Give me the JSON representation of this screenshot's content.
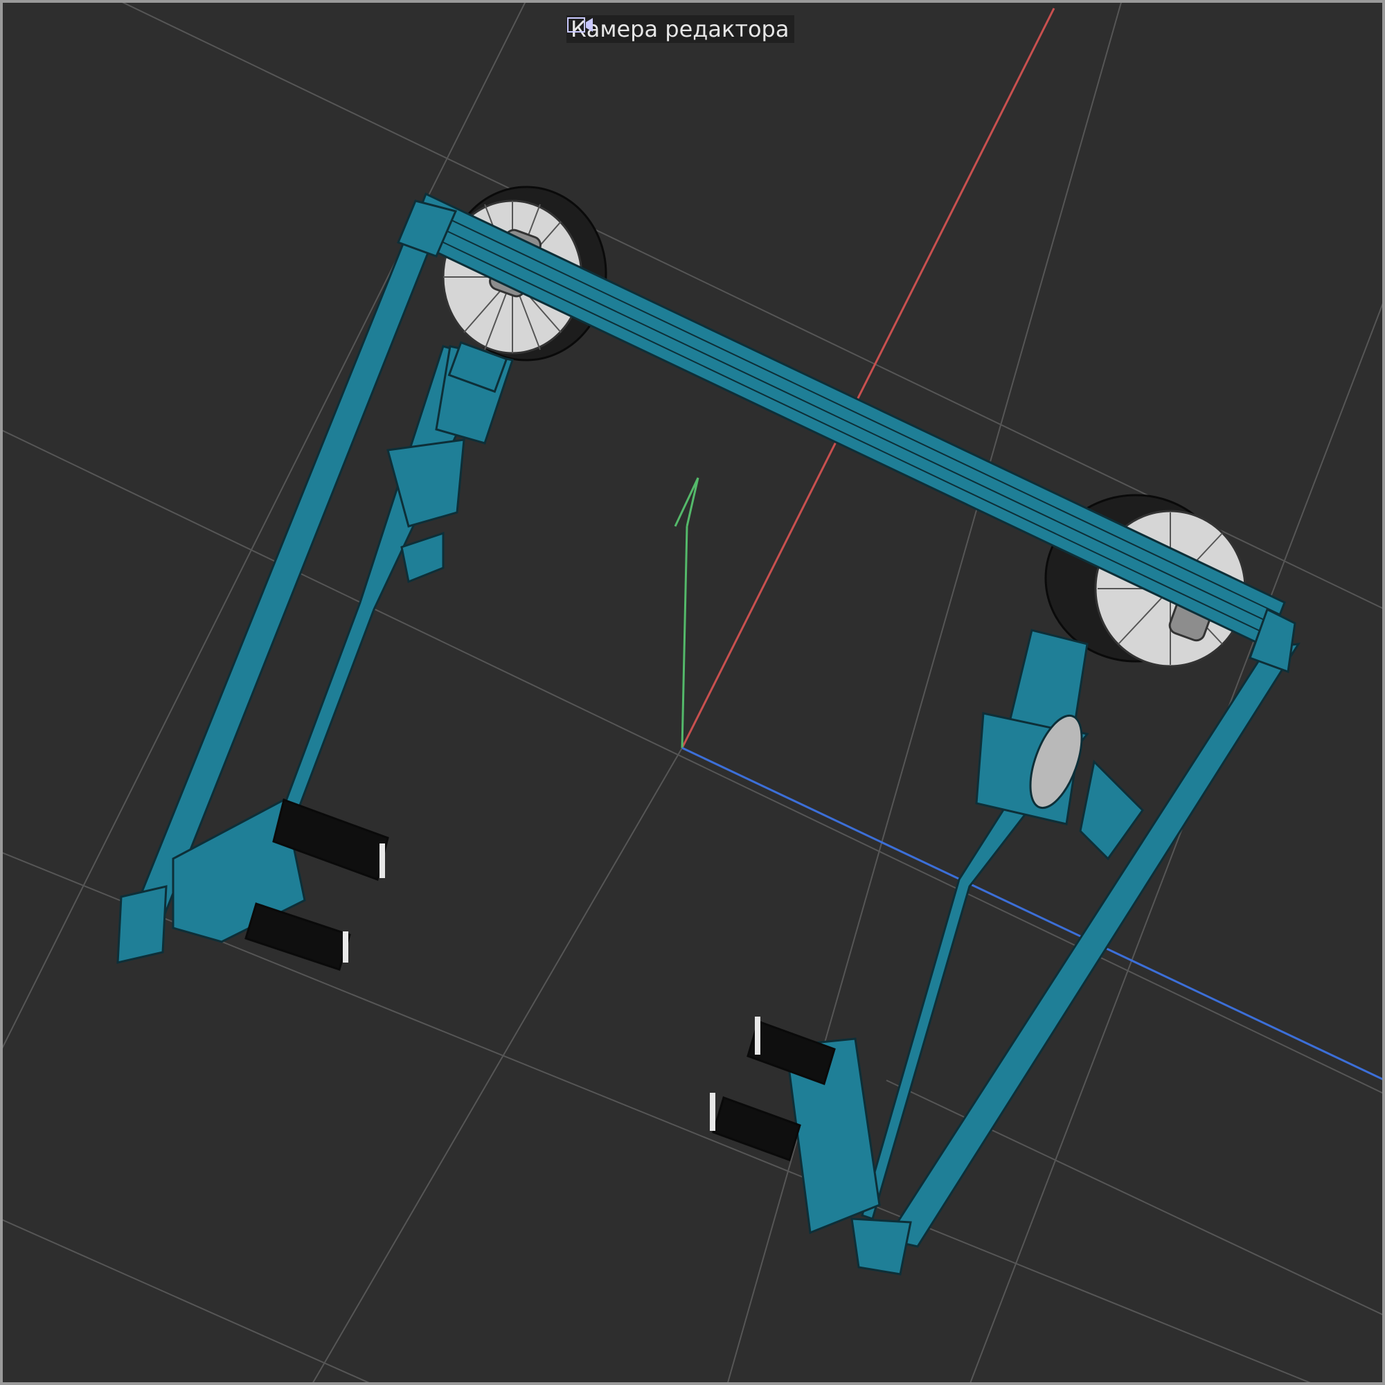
{
  "viewport": {
    "camera_label": "Камера редактора",
    "camera_icon": "camera-icon",
    "axes": {
      "x_color": "#c8504f",
      "y_color": "#54b96a",
      "z_color": "#3c6fd8"
    },
    "colors": {
      "background": "#2e2e2e",
      "grid": "#545454",
      "frame": "#1f7f97",
      "frame_edge": "#0d2f38",
      "wheel": "#d6d6d6"
    }
  }
}
